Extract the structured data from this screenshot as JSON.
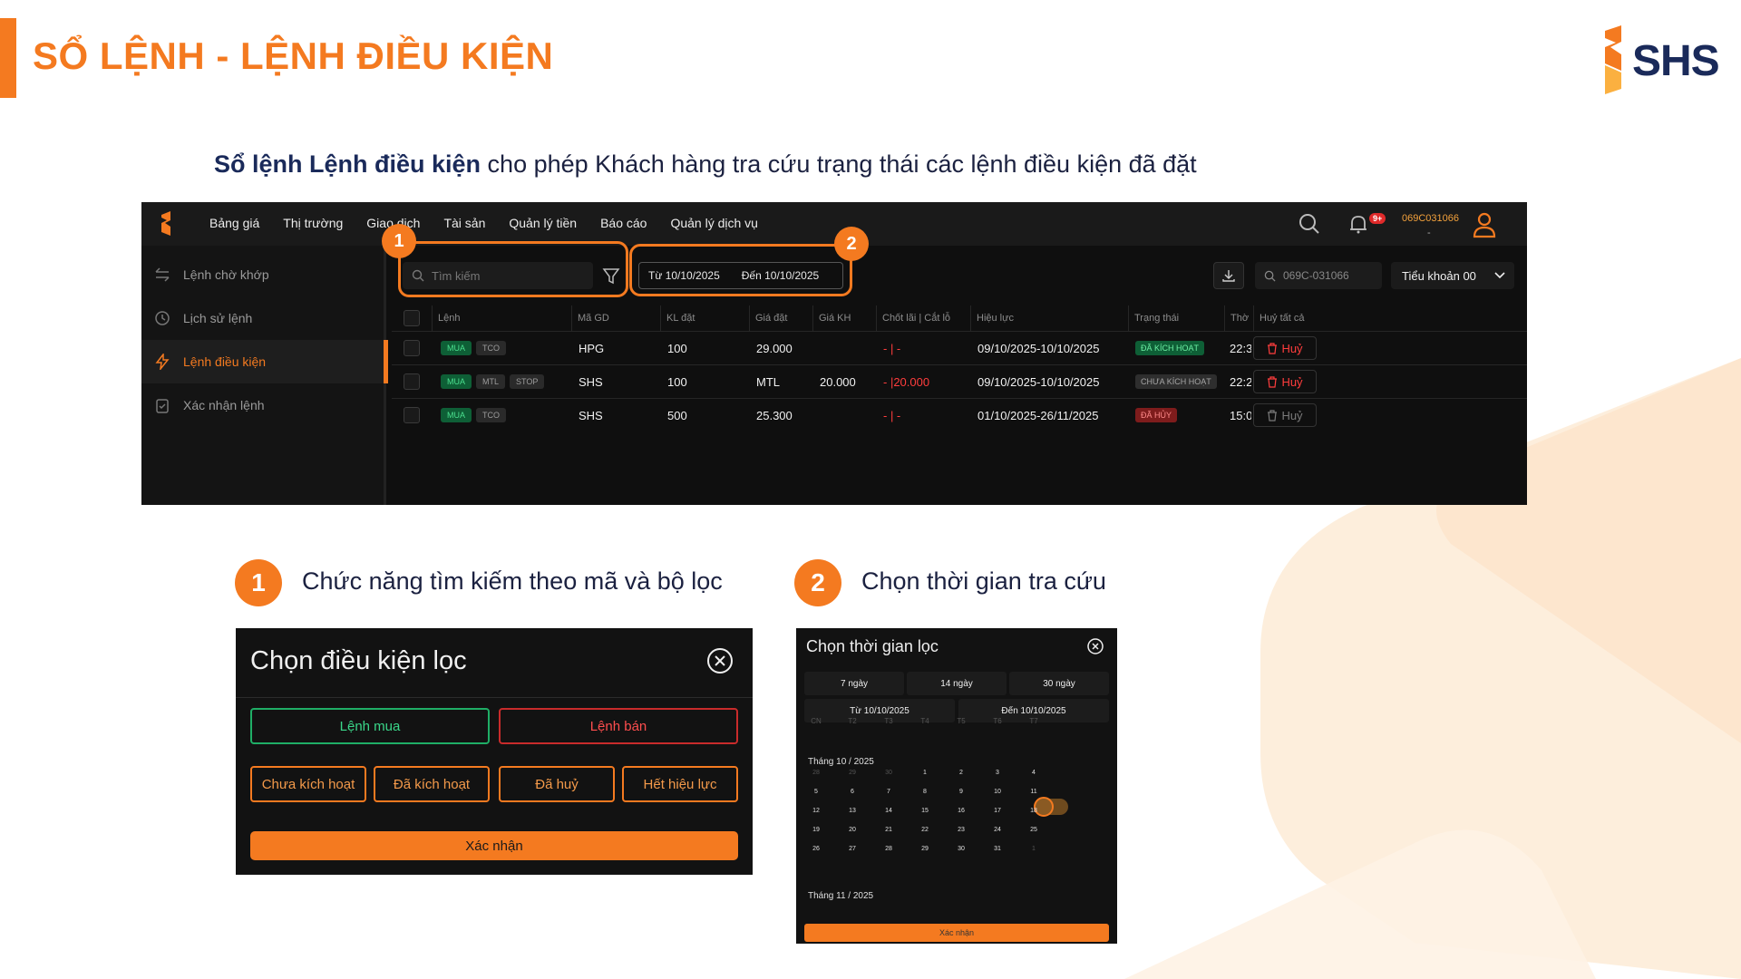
{
  "slide": {
    "title": "SỔ LỆNH - LỆNH ĐIỀU KIỆN",
    "brand": "SHS",
    "subtitle_bold": "Sổ lệnh Lệnh điều kiện",
    "subtitle_rest": " cho phép Khách hàng tra cứu trạng thái các lệnh điều kiện đã đặt",
    "accent_color": "#f47a20"
  },
  "app": {
    "nav": [
      "Bảng giá",
      "Thị trường",
      "Giao dịch",
      "Tài sản",
      "Quản lý tiền",
      "Báo cáo",
      "Quản lý dịch vụ"
    ],
    "notification_badge": "9+",
    "account_code": "069C031066",
    "account_sub": "-",
    "sidebar": [
      {
        "label": "Lệnh chờ khớp",
        "icon": "swap-icon",
        "active": false
      },
      {
        "label": "Lịch sử lệnh",
        "icon": "clock-icon",
        "active": false
      },
      {
        "label": "Lệnh điều kiện",
        "icon": "lightning-icon",
        "active": true
      },
      {
        "label": "Xác nhận lệnh",
        "icon": "clipboard-check-icon",
        "active": false
      }
    ],
    "search_placeholder": "Tìm kiếm",
    "date_from": "Từ  10/10/2025",
    "date_to": "Đến  10/10/2025",
    "account_search": "069C-031066",
    "subaccount": "Tiểu khoản 00",
    "callouts": [
      "1",
      "2"
    ],
    "columns": [
      "Lệnh",
      "Mã GD",
      "KL đặt",
      "Giá đặt",
      "Giá KH",
      "Chốt lãi | Cắt lỗ",
      "Hiệu lực",
      "Trạng thái",
      "Thờ",
      "Huỷ tất cả"
    ],
    "rows": [
      {
        "side": "MUA",
        "types": [
          "TCO"
        ],
        "symbol": "HPG",
        "qty": "100",
        "price": "29.000",
        "trigger": "",
        "tp": "- | -",
        "tp_red": "",
        "validity": "09/10/2025-10/10/2025",
        "status": "ĐÃ KÍCH HOẠT",
        "status_kind": "active",
        "time": "22:3",
        "cancel": "Huỷ",
        "cancel_enabled": true
      },
      {
        "side": "MUA",
        "types": [
          "MTL",
          "STOP"
        ],
        "symbol": "SHS",
        "qty": "100",
        "price": "MTL",
        "trigger": "20.000",
        "tp": "- | ",
        "tp_red": "20.000",
        "validity": "09/10/2025-10/10/2025",
        "status": "CHƯA KÍCH HOẠT",
        "status_kind": "inactive",
        "time": "22:2",
        "cancel": "Huỷ",
        "cancel_enabled": true
      },
      {
        "side": "MUA",
        "types": [
          "TCO"
        ],
        "symbol": "SHS",
        "qty": "500",
        "price": "25.300",
        "trigger": "",
        "tp": "- | -",
        "tp_red": "",
        "validity": "01/10/2025-26/11/2025",
        "status": "ĐÃ HỦY",
        "status_kind": "cancel",
        "time": "15:0",
        "cancel": "Huỷ",
        "cancel_enabled": false
      }
    ]
  },
  "features": [
    {
      "num": "1",
      "label": "Chức năng tìm kiếm theo mã và bộ lọc"
    },
    {
      "num": "2",
      "label": "Chọn thời gian tra cứu"
    }
  ],
  "filter_modal": {
    "title": "Chọn điều kiện lọc",
    "buy": "Lệnh mua",
    "sell": "Lệnh bán",
    "statuses": [
      "Chưa kích hoạt",
      "Đã kích hoạt",
      "Đã huỷ",
      "Hết hiệu lực"
    ],
    "confirm": "Xác nhận"
  },
  "date_modal": {
    "title": "Chọn thời gian lọc",
    "presets": [
      "7 ngày",
      "14 ngày",
      "30 ngày"
    ],
    "from": "Từ 10/10/2025",
    "to": "Đến 10/10/2025",
    "weekdays": [
      "CN",
      "T2",
      "T3",
      "T4",
      "T5",
      "T6",
      "T7"
    ],
    "month1": "Tháng 10 / 2025",
    "weeks": [
      [
        "28",
        "29",
        "30",
        "1",
        "2",
        "3",
        "4"
      ],
      [
        "5",
        "6",
        "7",
        "8",
        "9",
        "10",
        "11"
      ],
      [
        "12",
        "13",
        "14",
        "15",
        "16",
        "17",
        "18"
      ],
      [
        "19",
        "20",
        "21",
        "22",
        "23",
        "24",
        "25"
      ],
      [
        "26",
        "27",
        "28",
        "29",
        "30",
        "31",
        "1"
      ]
    ],
    "selected_day": "10",
    "month2": "Tháng 11 / 2025",
    "confirm": "Xác nhận"
  }
}
